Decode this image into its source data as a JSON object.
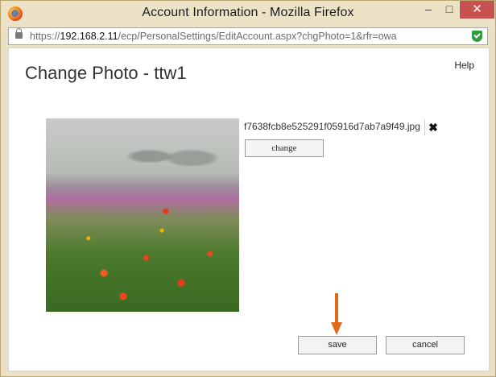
{
  "window": {
    "title": "Account Information - Mozilla Firefox",
    "minimize": "–",
    "maximize": "□",
    "close": "✕"
  },
  "urlbar": {
    "scheme": "https://",
    "host": "192.168.2.11",
    "path": "/ecp/PersonalSettings/EditAccount.aspx?chgPhoto=1&rfr=owa"
  },
  "page": {
    "title": "Change Photo - ttw1",
    "help": "Help"
  },
  "photo": {
    "filename": "f7638fcb8e525291f05916d7ab7a9f49.jpg",
    "remove_icon": "✖",
    "change_label": "change"
  },
  "actions": {
    "save_label": "save",
    "cancel_label": "cancel"
  },
  "colors": {
    "window_frame": "#eae0c5",
    "close_button": "#c75050",
    "arrow": "#e06a1c",
    "shield": "#2e9e3c"
  }
}
